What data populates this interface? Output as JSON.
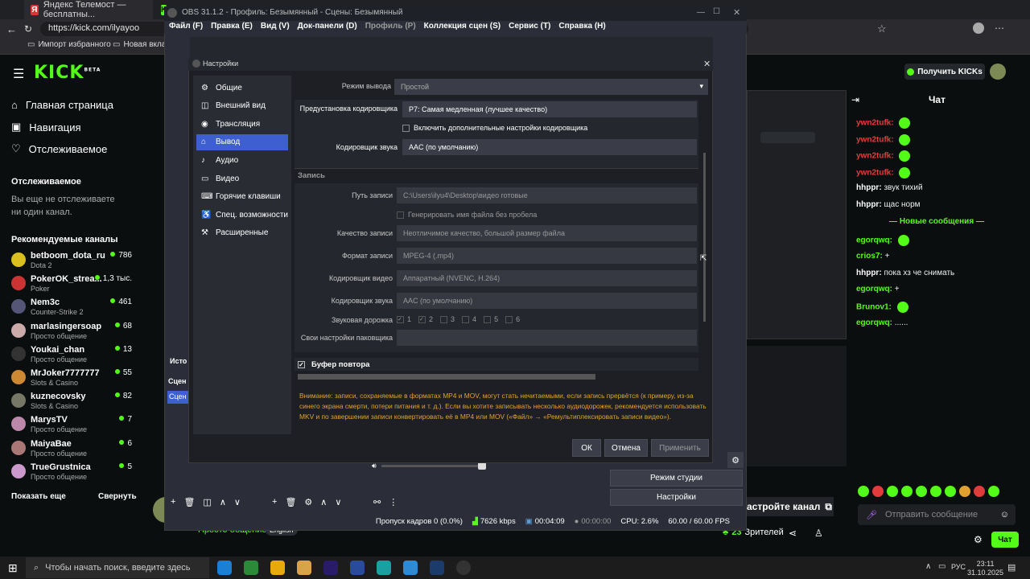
{
  "browser": {
    "tabs": [
      "Яндекс Телемост — бесплатны...",
      "K"
    ],
    "url": "https://kick.com/ilyayoo",
    "bookmarks": [
      "Импорт избранного",
      "Новая вклад"
    ]
  },
  "kick": {
    "logo": "KICK",
    "logo_sup": "BETA",
    "get_kicks": "Получить KICKs",
    "nav": [
      "Главная страница",
      "Навигация",
      "Отслеживаемое"
    ],
    "following_title": "Отслеживаемое",
    "following_empty": "Вы еще не отслеживаете ни один канал.",
    "recommended_title": "Рекомендуемые каналы",
    "channels": [
      {
        "name": "betboom_dota_ru",
        "cat": "Dota 2",
        "viewers": "786",
        "color": "#d9c01e"
      },
      {
        "name": "PokerOK_strea...",
        "cat": "Poker",
        "viewers": "1,3 тыс.",
        "color": "#c33"
      },
      {
        "name": "Nem3c",
        "cat": "Counter-Strike 2",
        "viewers": "461",
        "color": "#557"
      },
      {
        "name": "marlasingersoap",
        "cat": "Просто общение",
        "viewers": "68",
        "color": "#caa"
      },
      {
        "name": "Youkai_chan",
        "cat": "Просто общение",
        "viewers": "13",
        "color": "#333"
      },
      {
        "name": "MrJoker7777777",
        "cat": "Slots & Casino",
        "viewers": "55",
        "color": "#c83"
      },
      {
        "name": "kuznecovsky",
        "cat": "Slots & Casino",
        "viewers": "82",
        "color": "#776"
      },
      {
        "name": "MarysTV",
        "cat": "Просто общение",
        "viewers": "7",
        "color": "#b8a"
      },
      {
        "name": "MaiyaBae",
        "cat": "Просто общение",
        "viewers": "6",
        "color": "#a77"
      },
      {
        "name": "TrueGrustnica",
        "cat": "Просто общение",
        "viewers": "5",
        "color": "#c9c"
      }
    ],
    "show_more": "Показать еще",
    "collapse": "Свернуть",
    "category": "Просто общение",
    "lang": "English",
    "viewers": "23",
    "viewers_label": "Зрителей",
    "customize": "астройте канал",
    "chat_title": "Чат",
    "chat": [
      {
        "user": "ywn2tufk:",
        "text": "",
        "ucolor": "#e23b3b",
        "emote": true
      },
      {
        "user": "ywn2tufk:",
        "text": "",
        "ucolor": "#e23b3b",
        "emote": true
      },
      {
        "user": "ywn2tufk:",
        "text": "",
        "ucolor": "#e23b3b",
        "emote": true
      },
      {
        "user": "ywn2tufk:",
        "text": "",
        "ucolor": "#e23b3b",
        "emote": true
      },
      {
        "user": "hhppr:",
        "text": "звук тихий",
        "ucolor": "#ffffff",
        "emote": false
      },
      {
        "user": "hhppr:",
        "text": "щас норм",
        "ucolor": "#ffffff",
        "emote": false
      }
    ],
    "new_messages": "Новые сообщения",
    "chat2": [
      {
        "user": "egorqwq:",
        "text": "",
        "ucolor": "#53fc18",
        "emote": true
      },
      {
        "user": "crios7:",
        "text": "+",
        "ucolor": "#53fc18",
        "emote": false
      },
      {
        "user": "hhppr:",
        "text": "пока хз че снимать",
        "ucolor": "#ffffff",
        "emote": false
      },
      {
        "user": "egorqwq:",
        "text": "+",
        "ucolor": "#53fc18",
        "emote": false
      },
      {
        "user": "Brunov1:",
        "text": "",
        "ucolor": "#53fc18",
        "emote": true
      },
      {
        "user": "egorqwq:",
        "text": "......",
        "ucolor": "#53fc18",
        "emote": false
      }
    ],
    "send_placeholder": "Отправить сообщение",
    "chat_btn": "Чат"
  },
  "obs": {
    "title": "OBS 31.1.2 - Профиль: Безымянный - Сцены: Безымянный",
    "menu": [
      "Файл (F)",
      "Правка (E)",
      "Вид (V)",
      "Док-панели (D)",
      "Профиль (P)",
      "Коллекция сцен (S)",
      "Сервис (T)",
      "Справка (H)"
    ],
    "studio_mode": "Режим студии",
    "settings": "Настройки",
    "status": {
      "dropped": "Пропуск кадров 0 (0.0%)",
      "bitrate": "7626 kbps",
      "rec_time": "00:04:09",
      "stream_time": "00:00:00",
      "cpu": "CPU: 2.6%",
      "fps": "60.00 / 60.00 FPS"
    },
    "scene_labels": [
      "Исто",
      "Сцен",
      "Сцен"
    ]
  },
  "settings": {
    "title": "Настройки",
    "sidebar": [
      "Общие",
      "Внешний вид",
      "Трансляция",
      "Вывод",
      "Аудио",
      "Видео",
      "Горячие клавиши",
      "Спец. возможности",
      "Расширенные"
    ],
    "active": 3,
    "output_mode_label": "Режим вывода",
    "output_mode": "Простой",
    "preset_label": "Предустановка кодировщика",
    "preset": "P7: Самая медленная (лучшее качество)",
    "adv_encoder": "Включить дополнительные настройки кодировщика",
    "audio_enc_label": "Кодировщик звука",
    "audio_enc": "AAC (по умолчанию)",
    "recording_section": "Запись",
    "rec_path_label": "Путь записи",
    "rec_path": "C:\\Users\\ilyu4\\Desktop\\видео готовые",
    "no_space": "Генерировать имя файла без пробела",
    "quality_label": "Качество записи",
    "quality": "Неотличимое качество, большой размер файла",
    "format_label": "Формат записи",
    "format": "MPEG-4 (.mp4)",
    "venc_label": "Кодировщик видео",
    "venc": "Аппаратный (NVENC, H.264)",
    "aenc_label": "Кодировщик звука",
    "aenc": "AAC (по умолчанию)",
    "tracks_label": "Звуковая дорожка",
    "tracks": [
      "1",
      "2",
      "3",
      "4",
      "5",
      "6"
    ],
    "muxer_label": "Свои настройки паковщика",
    "replay_buffer": "Буфер повтора",
    "warning": "Внимание: записи, сохраняемые в форматах MP4 и MOV, могут стать нечитаемыми, если запись прервётся (к примеру, из-за синего экрана смерти, потери питания и т. д.). Если вы хотите записывать несколько аудиодорожек, рекомендуется использовать MKV и по завершении записи конвертировать её в MP4 или MOV («Файл» → «Ремультиплексировать записи видео»).",
    "ok": "ОК",
    "cancel": "Отмена",
    "apply": "Применить"
  },
  "taskbar": {
    "search": "Чтобы начать поиск, введите здесь",
    "lang": "РУС",
    "time": "23:11",
    "date": "31.10.2025"
  }
}
